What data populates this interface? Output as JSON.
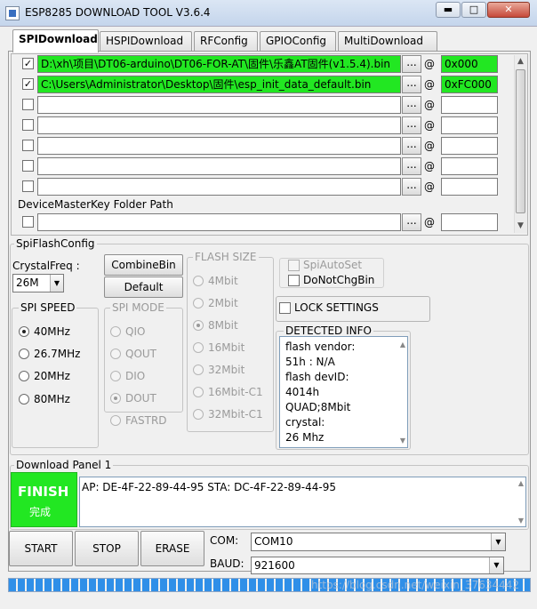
{
  "window": {
    "title": "ESP8285 DOWNLOAD TOOL V3.6.4",
    "min_glyph": "▬",
    "max_glyph": "□",
    "close_glyph": "✕"
  },
  "tabs": [
    {
      "label": "SPIDownload",
      "active": true
    },
    {
      "label": "HSPIDownload"
    },
    {
      "label": "RFConfig"
    },
    {
      "label": "GPIOConfig"
    },
    {
      "label": "MultiDownload"
    }
  ],
  "files": [
    {
      "checked": true,
      "path": "D:\\xh\\项目\\DT06-arduino\\DT06-FOR-AT\\固件\\乐鑫AT固件(v1.5.4).bin",
      "address": "0x000"
    },
    {
      "checked": true,
      "path": "C:\\Users\\Administrator\\Desktop\\固件\\esp_init_data_default.bin",
      "address": "0xFC000"
    },
    {
      "checked": false,
      "path": "",
      "address": ""
    },
    {
      "checked": false,
      "path": "",
      "address": ""
    },
    {
      "checked": false,
      "path": "",
      "address": ""
    },
    {
      "checked": false,
      "path": "",
      "address": ""
    }
  ],
  "browse_label": "...",
  "at_symbol": "@",
  "check_glyph": "✓",
  "device_master": {
    "label": "DeviceMasterKey Folder Path",
    "checked": false,
    "path": "",
    "address": ""
  },
  "spi_flash_config": {
    "label": "SpiFlashConfig",
    "crystal_label": "CrystalFreq :",
    "crystal_value": "26M",
    "combine_button": "CombineBin",
    "default_button": "Default",
    "spi_speed": {
      "label": "SPI SPEED",
      "options": [
        "40MHz",
        "26.7MHz",
        "20MHz",
        "80MHz"
      ],
      "selected": 0
    },
    "spi_mode": {
      "label": "SPI MODE",
      "options": [
        "QIO",
        "QOUT",
        "DIO",
        "DOUT",
        "FASTRD"
      ],
      "selected": 3
    },
    "flash_size": {
      "label": "FLASH SIZE",
      "options": [
        "4Mbit",
        "2Mbit",
        "8Mbit",
        "16Mbit",
        "32Mbit",
        "16Mbit-C1",
        "32Mbit-C1"
      ],
      "selected": 2
    },
    "spi_auto_set": "SpiAutoSet",
    "do_not_chg_bin": "DoNotChgBin",
    "lock_settings": "LOCK SETTINGS",
    "detected_info": {
      "label": "DETECTED INFO",
      "lines": [
        "flash vendor:",
        "51h : N/A",
        "flash devID:",
        "4014h",
        "QUAD;8Mbit",
        "crystal:",
        "26 Mhz"
      ]
    }
  },
  "download_panel": {
    "label": "Download Panel 1",
    "status_title": "FINISH",
    "status_sub": "完成",
    "mac_text": "AP:  DE-4F-22-89-44-95   STA:  DC-4F-22-89-44-95"
  },
  "controls": {
    "start": "START",
    "stop": "STOP",
    "erase": "ERASE",
    "com_label": "COM:",
    "com_value": "COM10",
    "baud_label": "BAUD:",
    "baud_value": "921600"
  },
  "colors": {
    "finish_green": "#22e722",
    "progress_blue": "#2f8fe8"
  },
  "progress_percent": 100,
  "watermark": "https://blog.csdn.net/weixin_37634442"
}
